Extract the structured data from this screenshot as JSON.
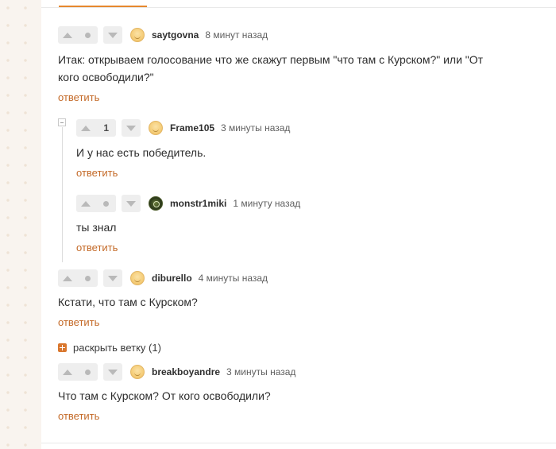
{
  "reply_label": "ответить",
  "expand_branch_label": "раскрыть ветку (1)",
  "comments": [
    {
      "author": "saytgovna",
      "time": "8 минут назад",
      "rating": "",
      "text_line1": "Итак: открываем голосование что же скажут первым \"что там с Курском?\" или \"От",
      "text_line2": "кого освободили?\""
    },
    {
      "author": "Frame105",
      "time": "3 минуты назад",
      "rating": "1",
      "text": "И у нас есть победитель."
    },
    {
      "author": "monstr1miki",
      "time": "1 минуту назад",
      "rating": "",
      "text": "ты знал"
    },
    {
      "author": "diburello",
      "time": "4 минуты назад",
      "rating": "",
      "text": "Кстати, что там с Курском?"
    },
    {
      "author": "breakboyandre",
      "time": "3 минуты назад",
      "rating": "",
      "text": "Что там с Курском? От кого освободили?"
    }
  ],
  "colors": {
    "accent": "#e6882e",
    "reply_link": "#c46a28",
    "vote_bg": "#eeeeee"
  }
}
